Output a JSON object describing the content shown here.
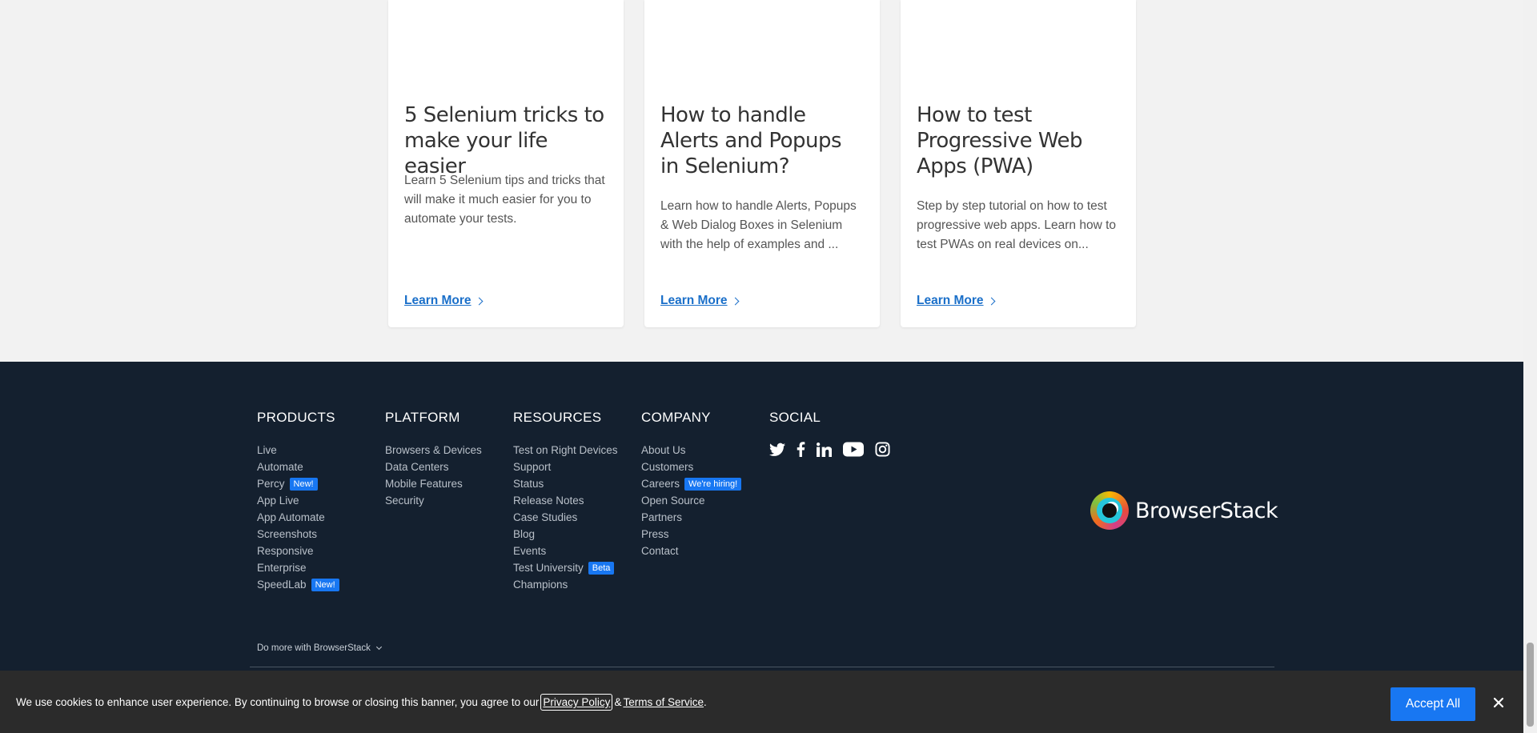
{
  "cards": [
    {
      "title": "5 Selenium tricks to make your life easier",
      "desc": "Learn 5 Selenium tips and tricks that will make it much easier for you to automate your tests.",
      "link": "Learn More"
    },
    {
      "title": "How to handle Alerts and Popups in Selenium?",
      "desc": "Learn how to handle Alerts, Popups & Web Dialog Boxes in Selenium with the help of examples and ...",
      "link": "Learn More"
    },
    {
      "title": "How to test Progressive Web Apps (PWA)",
      "desc": "Step by step tutorial on how to test progressive web apps. Learn how to test PWAs on real devices on...",
      "link": "Learn More"
    }
  ],
  "footer": {
    "products": {
      "heading": "PRODUCTS",
      "items": [
        "Live",
        "Automate",
        "Percy",
        "App Live",
        "App Automate",
        "Screenshots",
        "Responsive",
        "Enterprise",
        "SpeedLab"
      ],
      "percy_badge": "New!",
      "speedlab_badge": "New!"
    },
    "platform": {
      "heading": "PLATFORM",
      "items": [
        "Browsers & Devices",
        "Data Centers",
        "Mobile Features",
        "Security"
      ]
    },
    "resources": {
      "heading": "RESOURCES",
      "items": [
        "Test on Right Devices",
        "Support",
        "Status",
        "Release Notes",
        "Case Studies",
        "Blog",
        "Events",
        "Test University",
        "Champions"
      ],
      "test_university_badge": "Beta"
    },
    "company": {
      "heading": "COMPANY",
      "items": [
        "About Us",
        "Customers",
        "Careers",
        "Open Source",
        "Partners",
        "Press",
        "Contact"
      ],
      "careers_badge": "We're hiring!"
    },
    "social": {
      "heading": "SOCIAL",
      "icons": [
        "twitter-icon",
        "facebook-icon",
        "linkedin-icon",
        "youtube-icon",
        "instagram-icon"
      ]
    },
    "logo_text": "BrowserStack",
    "do_more": "Do more with BrowserStack"
  },
  "cookie": {
    "text_before": "We use cookies to enhance user experience. By continuing to browse or closing this banner, you agree to our",
    "privacy_link": "Privacy Policy",
    "amp": "&",
    "terms_link": "Terms of Service",
    "period": ".",
    "accept_label": "Accept All"
  },
  "colors": {
    "footer_bg": "#14202f",
    "accent": "#1877f2",
    "link": "#1a6fc9",
    "cookie_bg": "#2b2b2b"
  }
}
